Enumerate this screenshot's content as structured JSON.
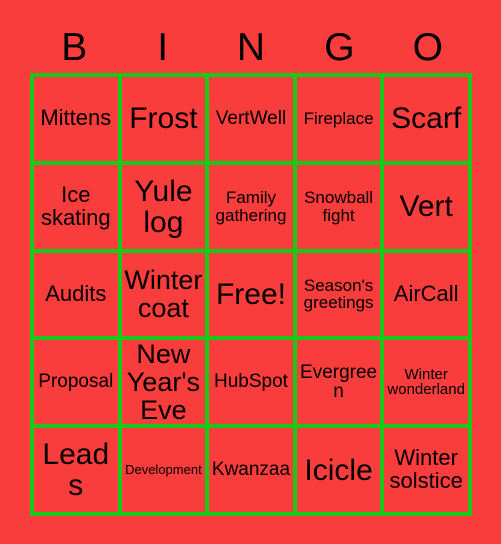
{
  "card": {
    "background_color": "#f93c3c",
    "border_color": "#19c819",
    "text_color": "#000000",
    "header": {
      "letters": [
        "B",
        "I",
        "N",
        "G",
        "O"
      ]
    },
    "columns": 5,
    "rows": 5,
    "cells": [
      {
        "label": "Mittens",
        "size": "fs-l",
        "free": false
      },
      {
        "label": "Frost",
        "size": "fs-xxl",
        "free": false
      },
      {
        "label": "VertWell",
        "size": "fs-m",
        "free": false
      },
      {
        "label": "Fireplace",
        "size": "fs-s",
        "free": false
      },
      {
        "label": "Scarf",
        "size": "fs-xxl",
        "free": false
      },
      {
        "label": "Ice skating",
        "size": "fs-l",
        "free": false
      },
      {
        "label": "Yule log",
        "size": "fs-xxl",
        "free": false
      },
      {
        "label": "Family gathering",
        "size": "fs-s",
        "free": false
      },
      {
        "label": "Snowball fight",
        "size": "fs-s",
        "free": false
      },
      {
        "label": "Vert",
        "size": "fs-xxl",
        "free": false
      },
      {
        "label": "Audits",
        "size": "fs-l",
        "free": false
      },
      {
        "label": "Winter coat",
        "size": "fs-xl",
        "free": false
      },
      {
        "label": "Free!",
        "size": "fs-xxl",
        "free": true
      },
      {
        "label": "Season's greetings",
        "size": "fs-s",
        "free": false
      },
      {
        "label": "AirCall",
        "size": "fs-l",
        "free": false
      },
      {
        "label": "Proposal",
        "size": "fs-m",
        "free": false
      },
      {
        "label": "New Year's Eve",
        "size": "fs-xl",
        "free": false
      },
      {
        "label": "HubSpot",
        "size": "fs-m",
        "free": false
      },
      {
        "label": "Evergreen",
        "size": "fs-m",
        "free": false
      },
      {
        "label": "Winter wonderland",
        "size": "fs-xs",
        "free": false
      },
      {
        "label": "Leads",
        "size": "fs-xxl",
        "free": false
      },
      {
        "label": "Development",
        "size": "fs-xxs",
        "free": false
      },
      {
        "label": "Kwanzaa",
        "size": "fs-m",
        "free": false
      },
      {
        "label": "Icicle",
        "size": "fs-xxl",
        "free": false
      },
      {
        "label": "Winter solstice",
        "size": "fs-l",
        "free": false
      }
    ]
  }
}
